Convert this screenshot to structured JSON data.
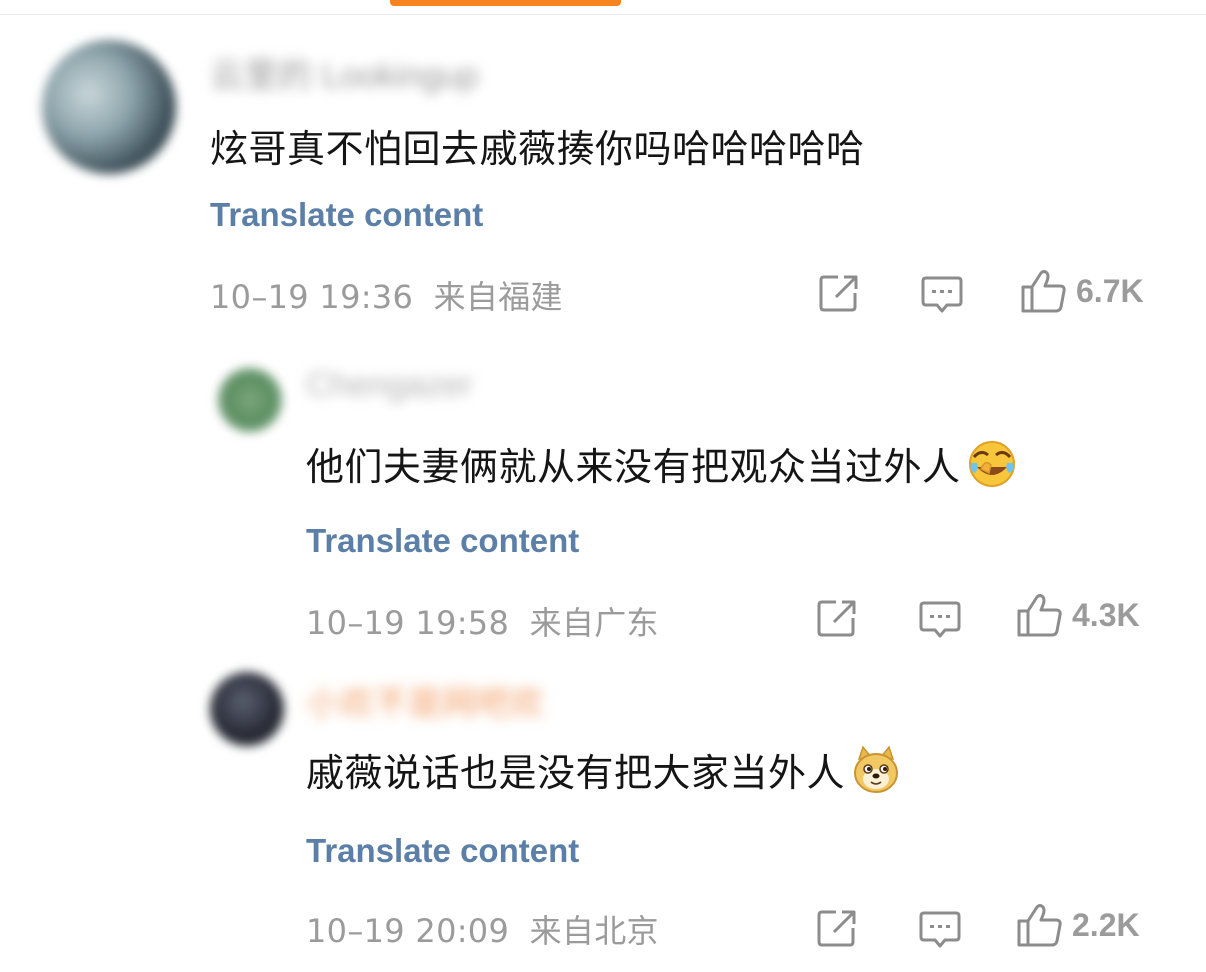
{
  "comments": [
    {
      "username": "云里的 Lookingup",
      "text": "炫哥真不怕回去戚薇揍你吗哈哈哈哈哈",
      "translate": "Translate content",
      "date": "10–19 19:36",
      "location": "来自福建",
      "likes": "6.7K",
      "emoji": null
    },
    {
      "username": "Chengazer",
      "text": "他们夫妻俩就从来没有把观众当过外人",
      "translate": "Translate content",
      "date": "10–19 19:58",
      "location": "来自广东",
      "likes": "4.3K",
      "emoji": "laugh-cry-emoji"
    },
    {
      "username": "小欢不是网吧欢",
      "text": "戚薇说话也是没有把大家当外人",
      "translate": "Translate content",
      "date": "10–19 20:09",
      "location": "来自北京",
      "likes": "2.2K",
      "emoji": "doge-emoji"
    }
  ],
  "icons": {
    "share": "share-icon",
    "reply": "comment-icon",
    "like": "thumbs-up-icon"
  },
  "colors": {
    "accent": "#f7841e",
    "link": "#5b7fa6",
    "meta": "#9b9b9b"
  }
}
